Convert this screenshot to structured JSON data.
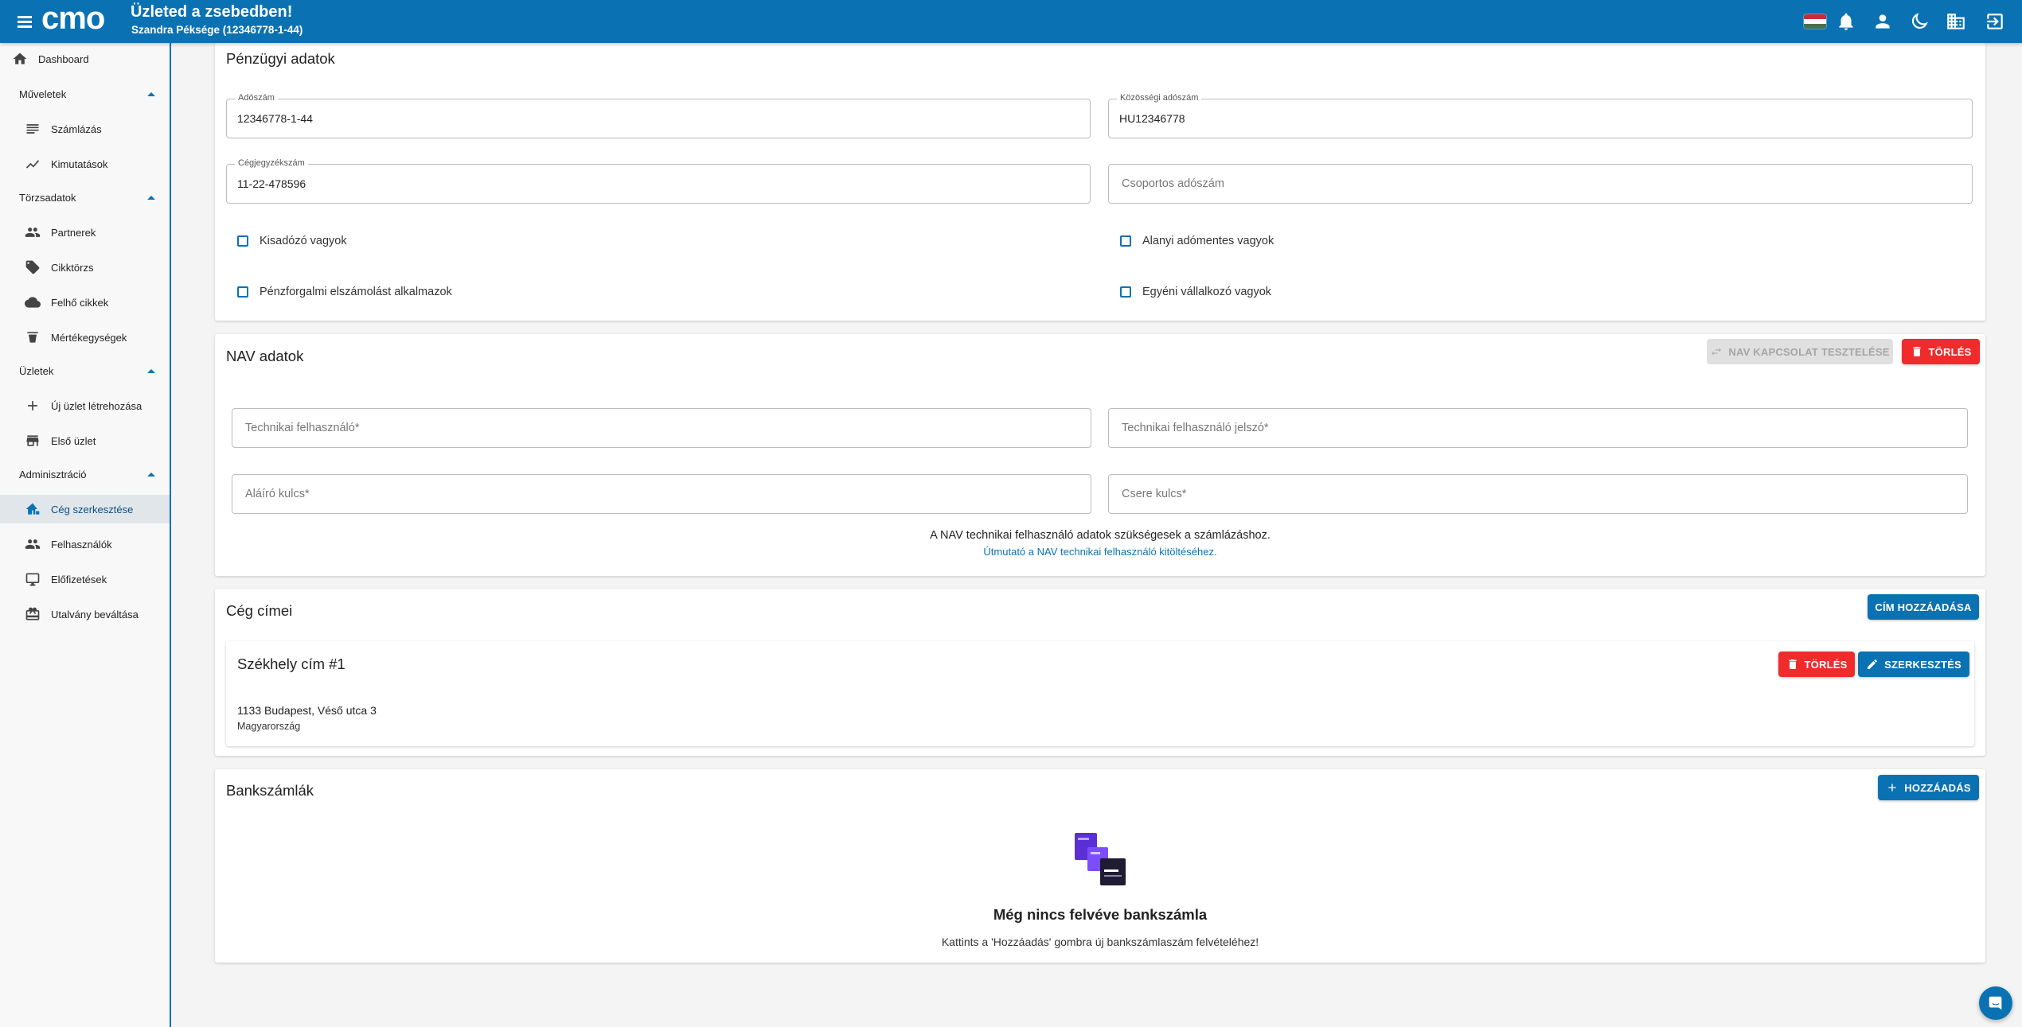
{
  "header": {
    "title": "Üzleted a zsebedben!",
    "subtitle": "Szandra Péksége (12346778-1-44)",
    "logo_text": "cmo",
    "accent": "#0a72b3"
  },
  "sidebar": {
    "dashboard": "Dashboard",
    "sections": [
      {
        "label": "Műveletek",
        "items": [
          {
            "label": "Számlázás",
            "icon": "receipt-icon"
          },
          {
            "label": "Kimutatások",
            "icon": "chart-icon"
          }
        ]
      },
      {
        "label": "Törzsadatok",
        "items": [
          {
            "label": "Partnerek",
            "icon": "people-icon"
          },
          {
            "label": "Cikktörzs",
            "icon": "tag-icon"
          },
          {
            "label": "Felhő cikkek",
            "icon": "cloud-icon"
          },
          {
            "label": "Mértékegységek",
            "icon": "scale-icon"
          }
        ]
      },
      {
        "label": "Üzletek",
        "items": [
          {
            "label": "Új üzlet létrehozása",
            "icon": "plus-icon"
          },
          {
            "label": "Első üzlet",
            "icon": "store-icon"
          }
        ]
      },
      {
        "label": "Adminisztráció",
        "items": [
          {
            "label": "Cég szerkesztése",
            "icon": "home-edit-icon",
            "active": true
          },
          {
            "label": "Felhasználók",
            "icon": "people-icon"
          },
          {
            "label": "Előfizetések",
            "icon": "monitor-icon"
          },
          {
            "label": "Utalvány beváltása",
            "icon": "gift-icon"
          }
        ]
      }
    ]
  },
  "financial": {
    "title": "Pénzügyi adatok",
    "tax_number_label": "Adószám",
    "tax_number": "12346778-1-44",
    "eu_tax_label": "Közösségi adószám",
    "eu_tax": "HU12346778",
    "reg_label": "Cégjegyzékszám",
    "reg_number": "11-22-478596",
    "group_tax_placeholder": "Csoportos adószám",
    "checkbox_small_taxpayer": "Kisadózó vagyok",
    "checkbox_vat_exempt": "Alanyi adómentes vagyok",
    "checkbox_cash_accounting": "Pénzforgalmi elszámolást alkalmazok",
    "checkbox_sole_trader": "Egyéni vállalkozó vagyok"
  },
  "nav": {
    "title": "NAV adatok",
    "test_button": "NAV KAPCSOLAT TESZTELÉSE",
    "delete_button": "TÖRLÉS",
    "tech_user_placeholder": "Technikai felhasználó*",
    "tech_password_placeholder": "Technikai felhasználó jelszó*",
    "signing_key_placeholder": "Aláíró kulcs*",
    "exchange_key_placeholder": "Csere kulcs*",
    "info_text": "A NAV technikai felhasználó adatok szükségesek a számlázáshoz.",
    "guide_link": "Útmutató a NAV technikai felhasználó kitöltéséhez."
  },
  "addresses": {
    "title": "Cég címei",
    "add_button": "CÍM HOZZÁADÁSA",
    "items": [
      {
        "title": "Székhely cím #1",
        "line1": "1133 Budapest, Véső utca 3",
        "country": "Magyarország",
        "delete_label": "TÖRLÉS",
        "edit_label": "SZERKESZTÉS"
      }
    ]
  },
  "bank": {
    "title": "Bankszámlák",
    "add_button": "HOZZÁADÁS",
    "empty_title": "Még nincs felvéve bankszámla",
    "empty_text": "Kattints a 'Hozzáadás' gombra új bankszámlaszám felvételéhez!"
  },
  "colors": {
    "primary": "#0a72b3",
    "danger": "#ef2b2b",
    "sidebar_active": "#e1e6ea"
  }
}
